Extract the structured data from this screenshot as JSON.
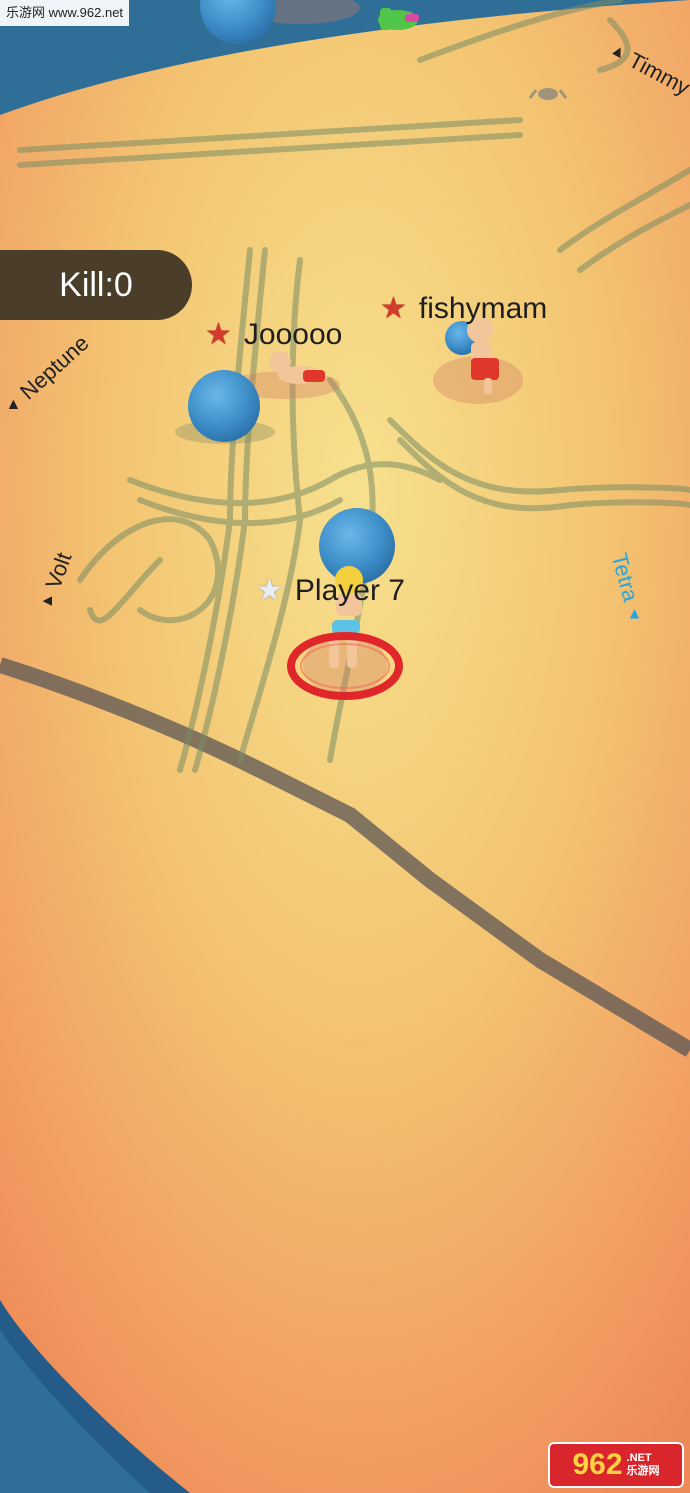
{
  "watermark_top": "乐游网 www.962.net",
  "hud": {
    "kill_label": "Kill:0"
  },
  "players": [
    {
      "name": "Jooooo",
      "star": "enemy-star"
    },
    {
      "name": "fishymam",
      "star": "enemy-star"
    },
    {
      "name": "Player 7",
      "star": "self-star"
    }
  ],
  "offscreen_players": [
    "Timmy",
    "Neptune",
    "Volt",
    "Tetra"
  ],
  "watermark_logo": {
    "number": "962",
    "suffix": ".NET",
    "subtitle": "乐游网"
  },
  "colors": {
    "sand": "#f4cc74",
    "sand_edge": "#f0955a",
    "water": "#2f6f97",
    "kill_panel": "#4a3e2a",
    "enemy_star": "#d23a2b",
    "tetra_label": "#2aa7d8",
    "ball": "#3f8fc9",
    "target_ring": "#e0262a"
  }
}
